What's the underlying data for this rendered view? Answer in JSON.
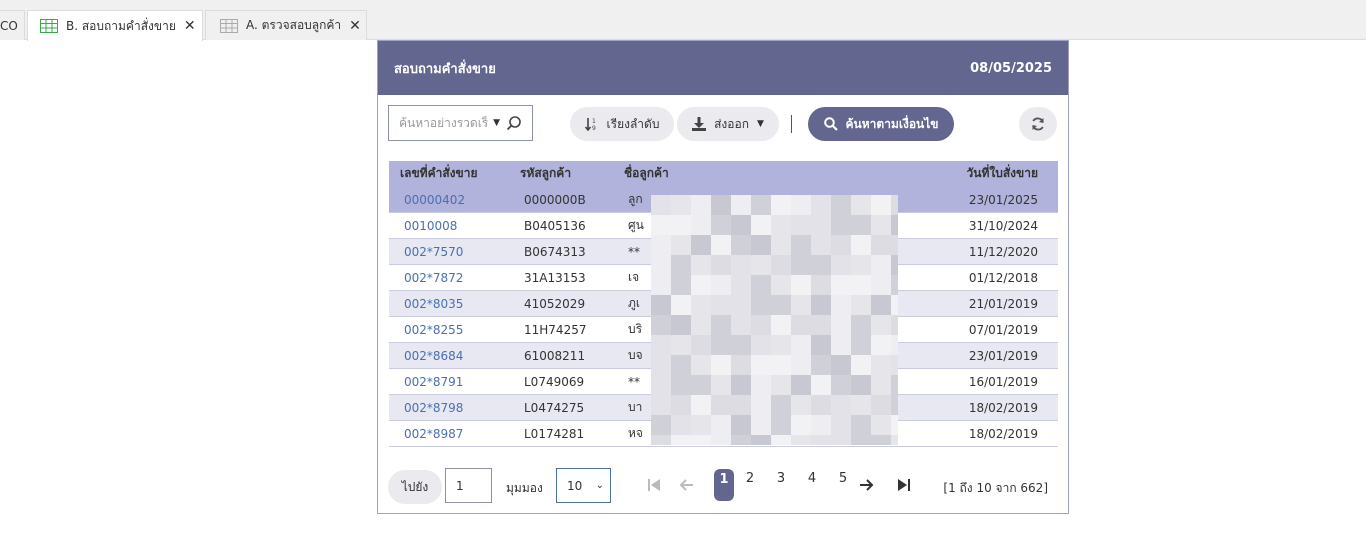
{
  "tabs": [
    {
      "label": "CO"
    },
    {
      "label": "B. สอบถามคำสั่งขาย",
      "icon": "grid-icon",
      "icon_color": "#3aa84a"
    },
    {
      "label": "A. ตรวจสอบลูกค้า",
      "icon": "grid-icon",
      "icon_color": "#aaaaaa"
    }
  ],
  "header": {
    "title": "สอบถามคำสั่งขาย",
    "date": "08/05/2025"
  },
  "toolbar": {
    "search_placeholder": "ค้นหาอย่างรวดเร็ว",
    "sort_label": "เรียงลำดับ",
    "export_label": "ส่งออก",
    "search_label": "ค้นหาตามเงื่อนไข"
  },
  "table": {
    "columns": [
      "เลขที่คำสั่งขาย",
      "รหัสลูกค้า",
      "ชื่อลูกค้า",
      "วันที่ใบสั่งขาย"
    ],
    "rows": [
      {
        "order": "00000402",
        "code": "0000000B",
        "name": "ลูก",
        "date": "23/01/2025"
      },
      {
        "order": "0010008",
        "code": "B0405136",
        "name": "ศูน",
        "date": "31/10/2024"
      },
      {
        "order": "002*7570",
        "code": "B0674313",
        "name": "**",
        "date": "11/12/2020"
      },
      {
        "order": "002*7872",
        "code": "31A13153",
        "name": "เจ",
        "date": "01/12/2018"
      },
      {
        "order": "002*8035",
        "code": "41052029",
        "name": "ภูเ",
        "date": "21/01/2019"
      },
      {
        "order": "002*8255",
        "code": "11H74257",
        "name": "บริ",
        "date": "07/01/2019"
      },
      {
        "order": "002*8684",
        "code": "61008211",
        "name": "บจ",
        "date": "23/01/2019"
      },
      {
        "order": "002*8791",
        "code": "L0749069",
        "name": "**",
        "date": "16/01/2019"
      },
      {
        "order": "002*8798",
        "code": "L0474275",
        "name": "บา",
        "date": "18/02/2019"
      },
      {
        "order": "002*8987",
        "code": "L0174281",
        "name": "หจ",
        "date": "18/02/2019"
      }
    ]
  },
  "pager": {
    "goto_label": "ไปยัง",
    "page_value": "1",
    "view_label": "มุมมอง",
    "page_size": "10",
    "pages": [
      "1",
      "2",
      "3",
      "4",
      "5"
    ],
    "summary": "[1 ถึง 10 จาก 662]"
  }
}
